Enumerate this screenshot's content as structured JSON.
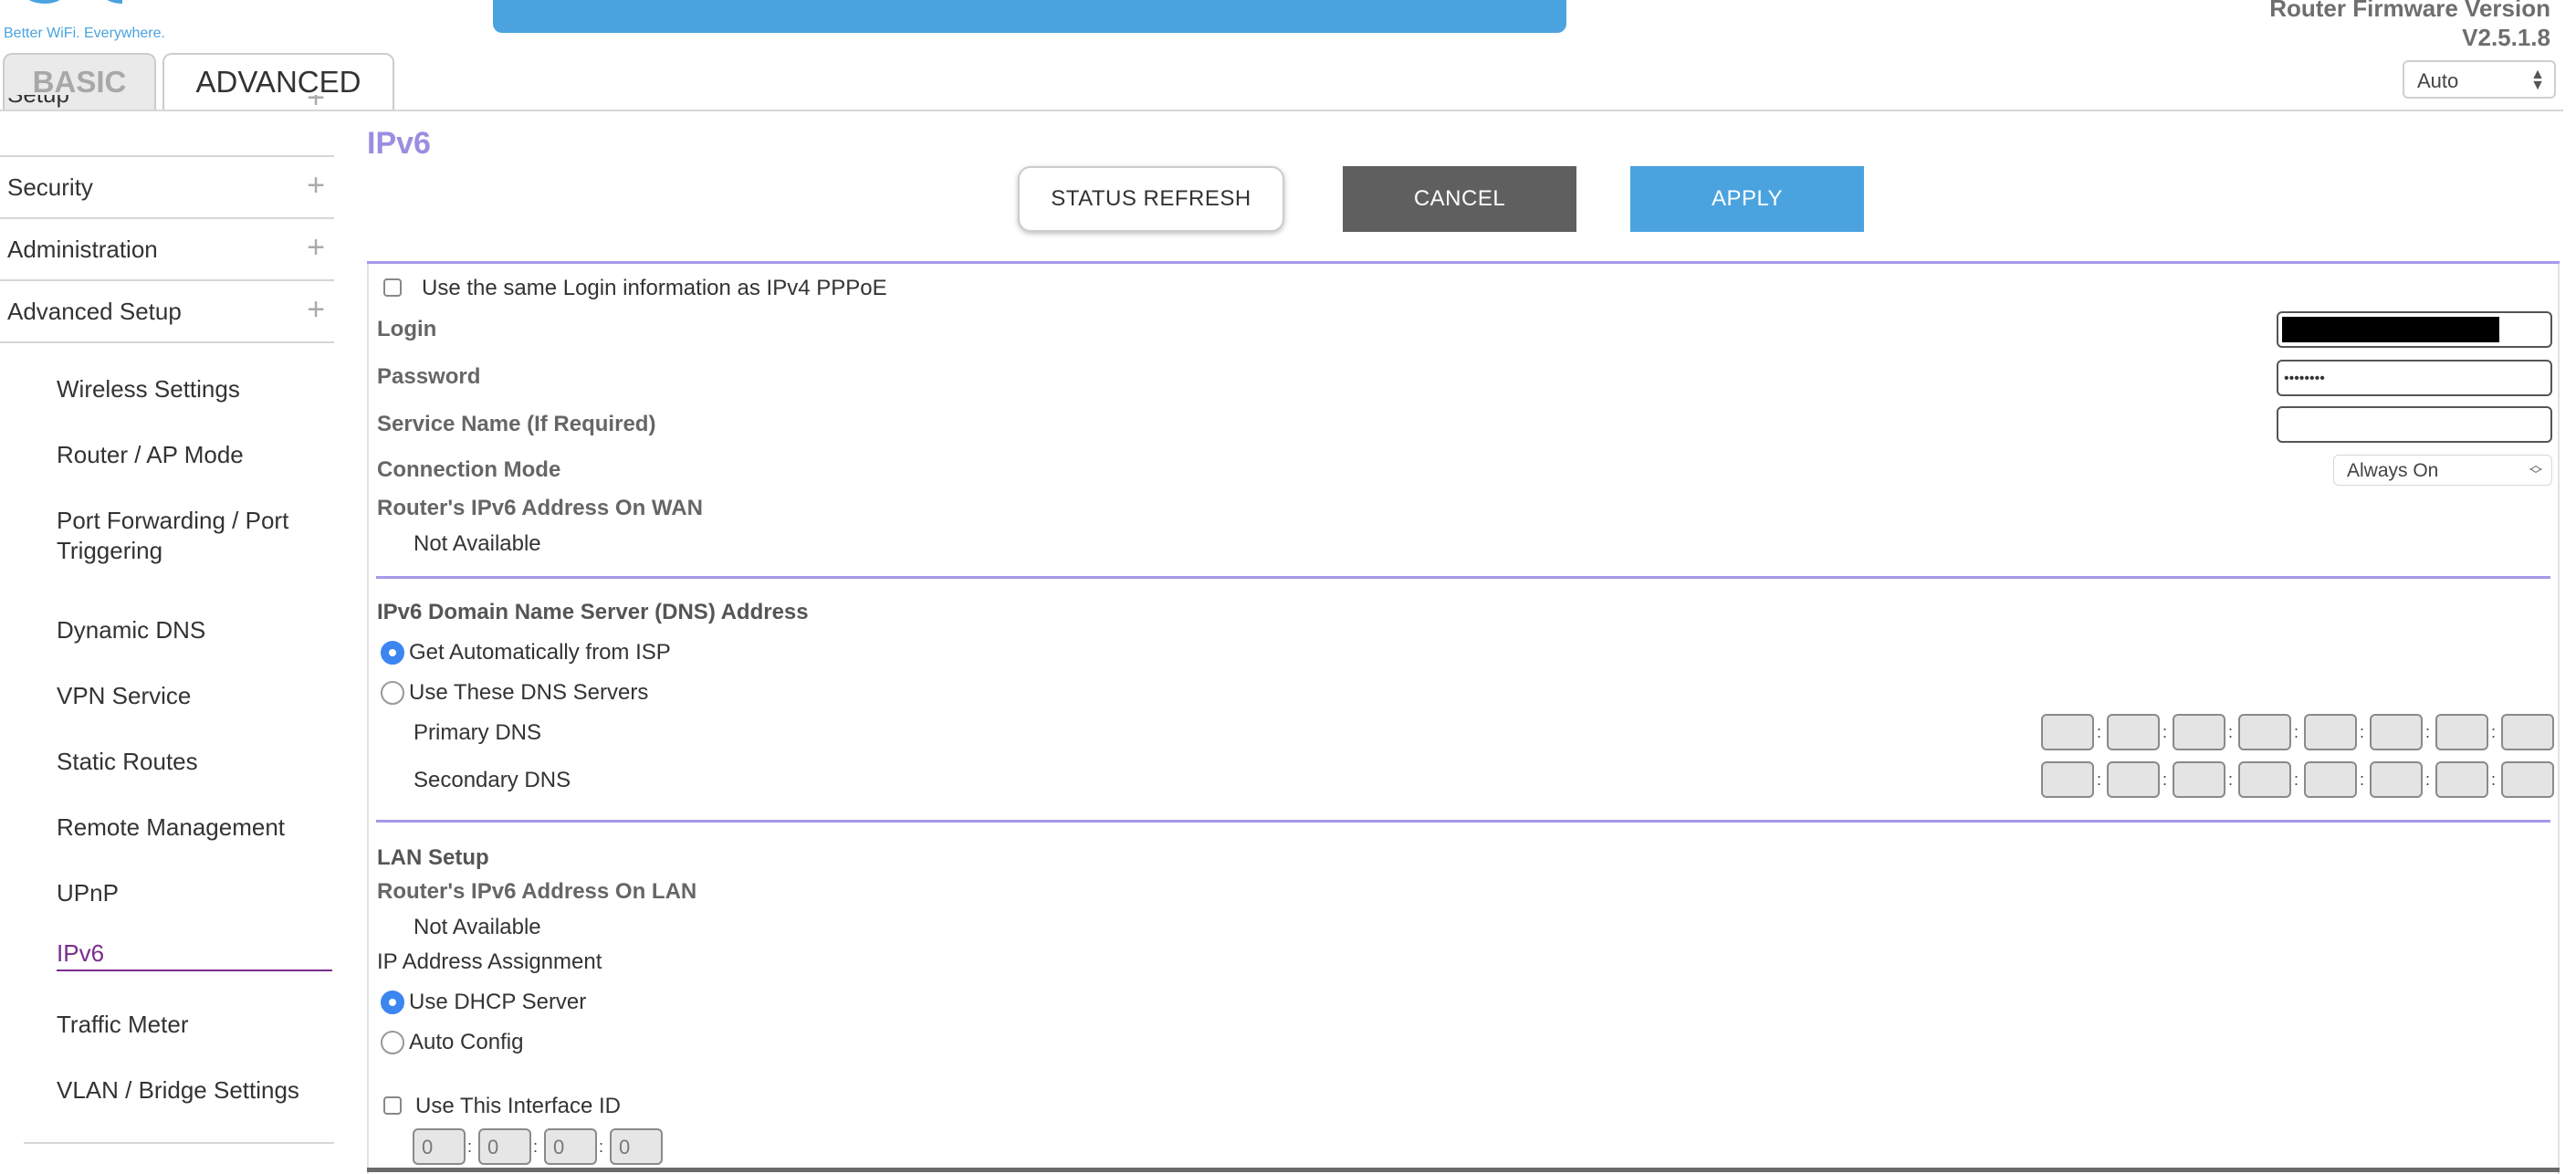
{
  "header": {
    "tagline": "Better WiFi. Everywhere.",
    "firmware_label": "Router Firmware Version",
    "firmware_version": "V2.5.1.8",
    "language_value": "Auto",
    "brand_color": "#4aa3df"
  },
  "tabs": [
    {
      "label": "BASIC",
      "active": false
    },
    {
      "label": "ADVANCED",
      "active": true
    }
  ],
  "sidebar": {
    "partial_top": "Setup",
    "categories": [
      {
        "label": "Security",
        "icon": "plus-icon"
      },
      {
        "label": "Administration",
        "icon": "plus-icon"
      },
      {
        "label": "Advanced Setup",
        "icon": "plus-icon"
      }
    ],
    "items": [
      {
        "label": "Wireless Settings"
      },
      {
        "label": "Router / AP Mode"
      },
      {
        "label": "Port Forwarding / Port Triggering"
      },
      {
        "label": "Dynamic DNS"
      },
      {
        "label": "VPN Service"
      },
      {
        "label": "Static Routes"
      },
      {
        "label": "Remote Management"
      },
      {
        "label": "UPnP"
      },
      {
        "label": "IPv6",
        "active": true
      },
      {
        "label": "Traffic Meter"
      },
      {
        "label": "VLAN / Bridge Settings"
      }
    ],
    "active_color": "#7a2d8c"
  },
  "main": {
    "title": "IPv6",
    "buttons": {
      "refresh": "STATUS REFRESH",
      "cancel": "CANCEL",
      "apply": "APPLY"
    },
    "same_login_label": "Use the same Login information as IPv4 PPPoE",
    "same_login_checked": false,
    "login_label": "Login",
    "password_label": "Password",
    "password_value": "••••••••",
    "service_label": "Service Name (If Required)",
    "service_value": "",
    "connection_mode_label": "Connection Mode",
    "connection_mode_value": "Always On",
    "wan_addr_label": "Router's IPv6 Address On WAN",
    "wan_addr_value": "Not Available",
    "dns": {
      "title": "IPv6 Domain Name Server (DNS) Address",
      "option_auto": "Get Automatically from ISP",
      "option_manual": "Use These DNS Servers",
      "selected": "auto",
      "primary_label": "Primary DNS",
      "secondary_label": "Secondary DNS",
      "segments": 8
    },
    "lan": {
      "title": "LAN Setup",
      "addr_label": "Router's IPv6 Address On LAN",
      "addr_value": "Not Available",
      "assignment_label": "IP Address Assignment",
      "option_dhcp": "Use DHCP Server",
      "option_auto": "Auto Config",
      "selected": "dhcp",
      "interface_id_label": "Use This Interface ID",
      "interface_id_checked": false,
      "interface_id": [
        "0",
        "0",
        "0",
        "0"
      ]
    },
    "accent_color": "#a39ae8",
    "radio_color": "#3b86f0"
  }
}
